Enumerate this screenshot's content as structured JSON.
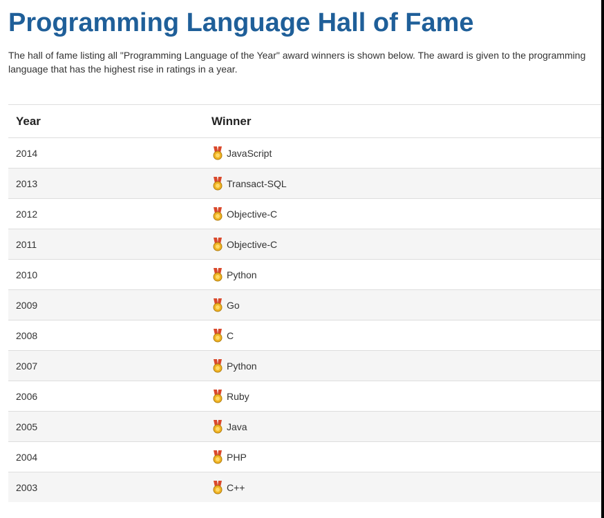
{
  "page": {
    "title": "Programming Language Hall of Fame",
    "intro_line_1": "The hall of fame listing all \"Programming Language of the Year\" award winners is shown below. The award is given to the programming",
    "intro_line_2": "language that has the highest rise in ratings in a year."
  },
  "table": {
    "headers": {
      "year": "Year",
      "winner": "Winner"
    },
    "winner_icon": "medal-icon",
    "rows": [
      {
        "year": "2014",
        "winner": "JavaScript"
      },
      {
        "year": "2013",
        "winner": "Transact-SQL"
      },
      {
        "year": "2012",
        "winner": "Objective-C"
      },
      {
        "year": "2011",
        "winner": "Objective-C"
      },
      {
        "year": "2010",
        "winner": "Python"
      },
      {
        "year": "2009",
        "winner": "Go"
      },
      {
        "year": "2008",
        "winner": "C"
      },
      {
        "year": "2007",
        "winner": "Python"
      },
      {
        "year": "2006",
        "winner": "Ruby"
      },
      {
        "year": "2005",
        "winner": "Java"
      },
      {
        "year": "2004",
        "winner": "PHP"
      },
      {
        "year": "2003",
        "winner": "C++"
      }
    ]
  },
  "colors": {
    "title": "#1f5f99",
    "text": "#333333",
    "row_stripe": "#f5f5f5",
    "border": "#dddddd",
    "medal_gold": "#f0b323",
    "medal_ribbon": "#d9482b"
  }
}
